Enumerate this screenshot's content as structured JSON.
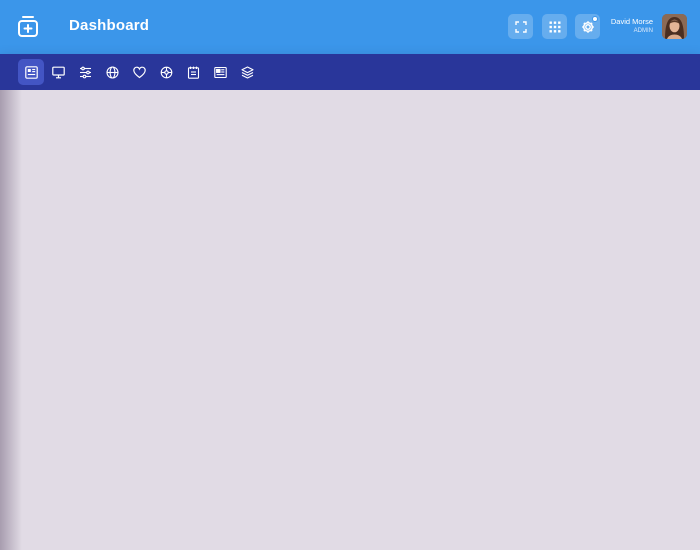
{
  "header": {
    "title": "Dashboard",
    "logo_icon": "first-aid-kit-icon",
    "actions": [
      {
        "name": "fullscreen",
        "icon": "expand-icon"
      },
      {
        "name": "apps",
        "icon": "grid-icon"
      },
      {
        "name": "settings",
        "icon": "gear-icon",
        "has_badge": true
      }
    ],
    "user": {
      "name": "David Morse",
      "role": "ADMIN"
    }
  },
  "nav": {
    "items": [
      {
        "name": "dashboard",
        "icon": "dashboard-icon",
        "active": true
      },
      {
        "name": "monitor",
        "icon": "monitor-icon",
        "active": false
      },
      {
        "name": "sliders",
        "icon": "sliders-icon",
        "active": false
      },
      {
        "name": "globe",
        "icon": "globe-icon",
        "active": false
      },
      {
        "name": "heart",
        "icon": "heart-icon",
        "active": false
      },
      {
        "name": "dribbble",
        "icon": "ball-icon",
        "active": false
      },
      {
        "name": "notebook",
        "icon": "notebook-icon",
        "active": false
      },
      {
        "name": "newspaper",
        "icon": "newspaper-icon",
        "active": false
      },
      {
        "name": "layers",
        "icon": "layers-icon",
        "active": false
      }
    ]
  },
  "colors": {
    "header_bg": "#3b96ea",
    "nav_bg": "#29369a",
    "nav_active": "#4355c4",
    "content_bg": "#e1dbe5"
  }
}
